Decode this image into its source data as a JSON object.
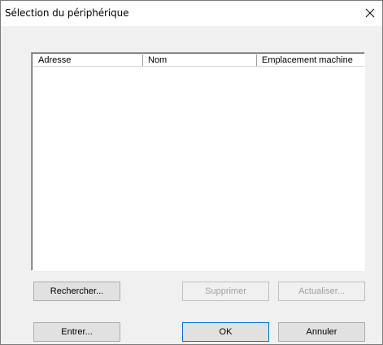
{
  "window": {
    "title": "Sélection du périphérique",
    "close_icon": "close-icon"
  },
  "list": {
    "columns": [
      "Adresse",
      "Nom",
      "Emplacement machine"
    ],
    "rows": []
  },
  "buttons": {
    "search": {
      "label": "Rechercher...",
      "enabled": true
    },
    "delete": {
      "label": "Supprimer",
      "enabled": false
    },
    "refresh": {
      "label": "Actualiser...",
      "enabled": false
    },
    "enter": {
      "label": "Entrer...",
      "enabled": true
    },
    "ok": {
      "label": "OK",
      "enabled": true,
      "default": true
    },
    "cancel": {
      "label": "Annuler",
      "enabled": true
    }
  },
  "colors": {
    "dialog_bg": "#f0f0f0",
    "titlebar_bg": "#ffffff",
    "focus_border": "#0078d7",
    "disabled_text": "#a0a0a0"
  }
}
